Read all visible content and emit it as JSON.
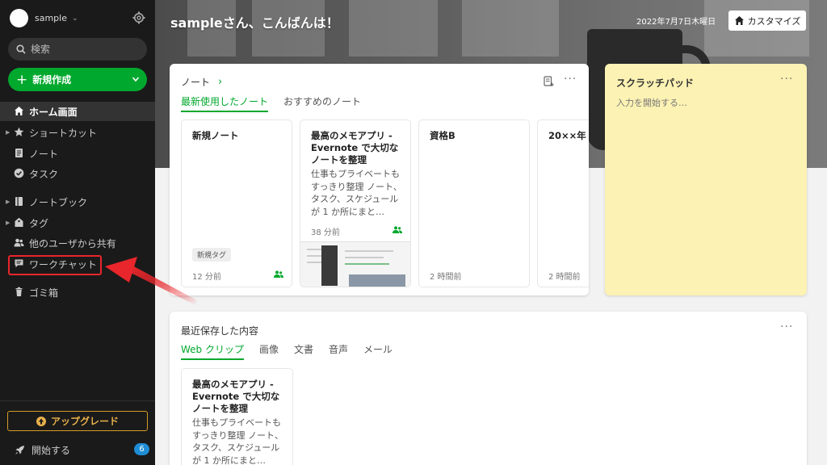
{
  "sidebar": {
    "account_name": "sample",
    "search_placeholder": "検索",
    "new_button": "新規作成",
    "items": [
      {
        "label": "ホーム画面"
      },
      {
        "label": "ショートカット"
      },
      {
        "label": "ノート"
      },
      {
        "label": "タスク"
      },
      {
        "label": "ノートブック"
      },
      {
        "label": "タグ"
      },
      {
        "label": "他のユーザから共有"
      },
      {
        "label": "ワークチャット"
      },
      {
        "label": "ゴミ箱"
      }
    ],
    "upgrade": "アップグレード",
    "start": "開始する",
    "start_badge": "6"
  },
  "header": {
    "greeting": "sampleさん、こんばんは！",
    "date": "2022年7月7日木曜日",
    "customize": "カスタマイズ"
  },
  "notes": {
    "title": "ノート",
    "tabs": [
      "最新使用したノート",
      "おすすめのノート"
    ],
    "cards": [
      {
        "title": "新規ノート",
        "tag": "新規タグ",
        "time": "12 分前"
      },
      {
        "title": "最高のメモアプリ - Evernote で大切なノートを整理",
        "body": "仕事もプライベートもすっきり整理 ノート、タスク、スケジュールが 1 か所にまと…",
        "time": "38 分前"
      },
      {
        "title": "資格B",
        "time": "2 時間前"
      },
      {
        "title": "20××年",
        "time": "2 時間前"
      }
    ]
  },
  "scratch": {
    "title": "スクラッチパッド",
    "placeholder": "入力を開始する…"
  },
  "recent": {
    "title": "最近保存した内容",
    "tabs": [
      "Web クリップ",
      "画像",
      "文書",
      "音声",
      "メール"
    ],
    "card": {
      "title": "最高のメモアプリ - Evernote で大切なノートを整理",
      "body": "仕事もプライベートもすっきり整理 ノート、タスク、スケジュールが 1 か所にまと…"
    }
  },
  "colors": {
    "accent": "#00a82d",
    "sidebar_bg": "#1a1a1a",
    "scratch_bg": "#fcf2b3",
    "highlight": "#e8262b",
    "upgrade": "#e8b04a"
  }
}
